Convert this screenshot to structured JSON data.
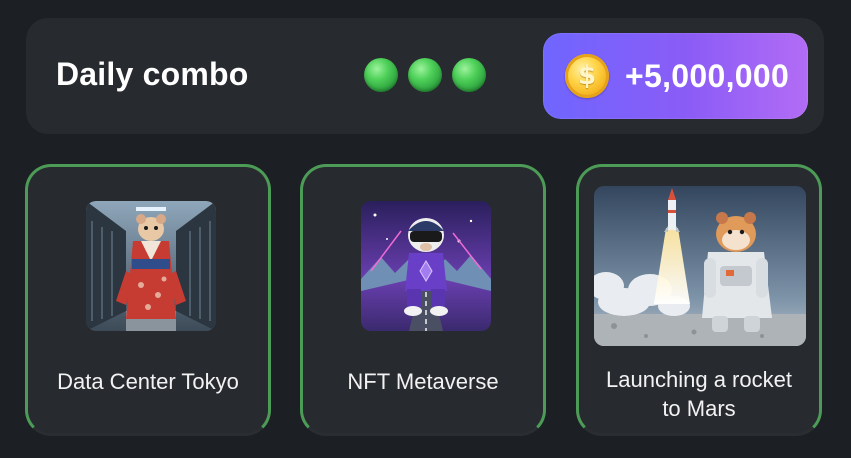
{
  "header": {
    "title": "Daily combo",
    "progress_dots": 3,
    "reward_amount": "+5,000,000",
    "coin_symbol": "$"
  },
  "cards": [
    {
      "label": "Data Center Tokyo",
      "image": "hamster-kimono-server-room"
    },
    {
      "label": "NFT Metaverse",
      "image": "hamster-vr-headset-running"
    },
    {
      "label": "Launching a rocket to Mars",
      "image": "hamster-astronaut-rocket-launch"
    }
  ],
  "colors": {
    "background": "#1c1f24",
    "panel": "#272a2f",
    "card_border": "#4c9b56",
    "dot_green": "#4fd15a",
    "reward_gradient_start": "#6f66ff",
    "reward_gradient_end": "#b26cf5",
    "coin_gold": "#ffd54a"
  }
}
